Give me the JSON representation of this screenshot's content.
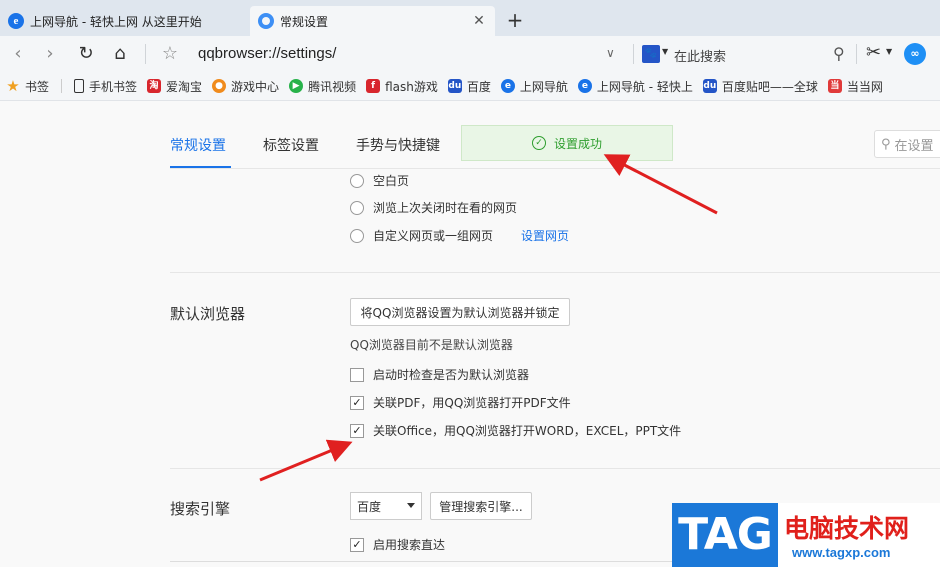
{
  "tabs": [
    {
      "title": "上网导航 - 轻快上网 从这里开始",
      "active": false,
      "icon": "ie-icon"
    },
    {
      "title": "常规设置",
      "active": true,
      "icon": "settings-page-icon"
    }
  ],
  "address_bar": {
    "url": "qqbrowser://settings/",
    "search_placeholder": "在此搜索"
  },
  "bookmarks": [
    {
      "label": "书签",
      "icon": "star-icon"
    },
    {
      "label": "手机书签",
      "icon": "phone-icon"
    },
    {
      "label": "爱淘宝",
      "icon": "taobao-icon"
    },
    {
      "label": "游戏中心",
      "icon": "game-icon"
    },
    {
      "label": "腾讯视频",
      "icon": "video-icon"
    },
    {
      "label": "flash游戏",
      "icon": "flash-icon"
    },
    {
      "label": "百度",
      "icon": "baidu-icon"
    },
    {
      "label": "上网导航",
      "icon": "ie-icon"
    },
    {
      "label": "上网导航 - 轻快上",
      "icon": "ie-icon"
    },
    {
      "label": "百度贴吧——全球",
      "icon": "baidu-icon"
    },
    {
      "label": "当当网",
      "icon": "dangdang-icon"
    }
  ],
  "settings": {
    "nav_tabs": [
      "常规设置",
      "标签设置",
      "手势与快捷键"
    ],
    "toast": "设置成功",
    "page_search_placeholder": "在设置",
    "startup_options": [
      "空白页",
      "浏览上次关闭时在看的网页",
      "自定义网页或一组网页"
    ],
    "set_pages_link": "设置网页",
    "default_browser": {
      "title": "默认浏览器",
      "set_default_button": "将QQ浏览器设置为默认浏览器并锁定",
      "status_note": "QQ浏览器目前不是默认浏览器",
      "options": [
        {
          "label": "启动时检查是否为默认浏览器",
          "checked": false
        },
        {
          "label": "关联PDF，用QQ浏览器打开PDF文件",
          "checked": true
        },
        {
          "label": "关联Office，用QQ浏览器打开WORD，EXCEL，PPT文件",
          "checked": true
        }
      ]
    },
    "search_engine": {
      "title": "搜索引擎",
      "selected": "百度",
      "manage_button": "管理搜索引擎...",
      "direct_option": {
        "label": "启用搜索直达",
        "checked": true
      }
    }
  },
  "watermark": {
    "tag": "TAG",
    "title": "电脑技术网",
    "url": "www.tagxp.com"
  },
  "colors": {
    "accent": "#1a73e8",
    "annotation_arrow": "#e02020",
    "success": "#2e9e2e"
  }
}
